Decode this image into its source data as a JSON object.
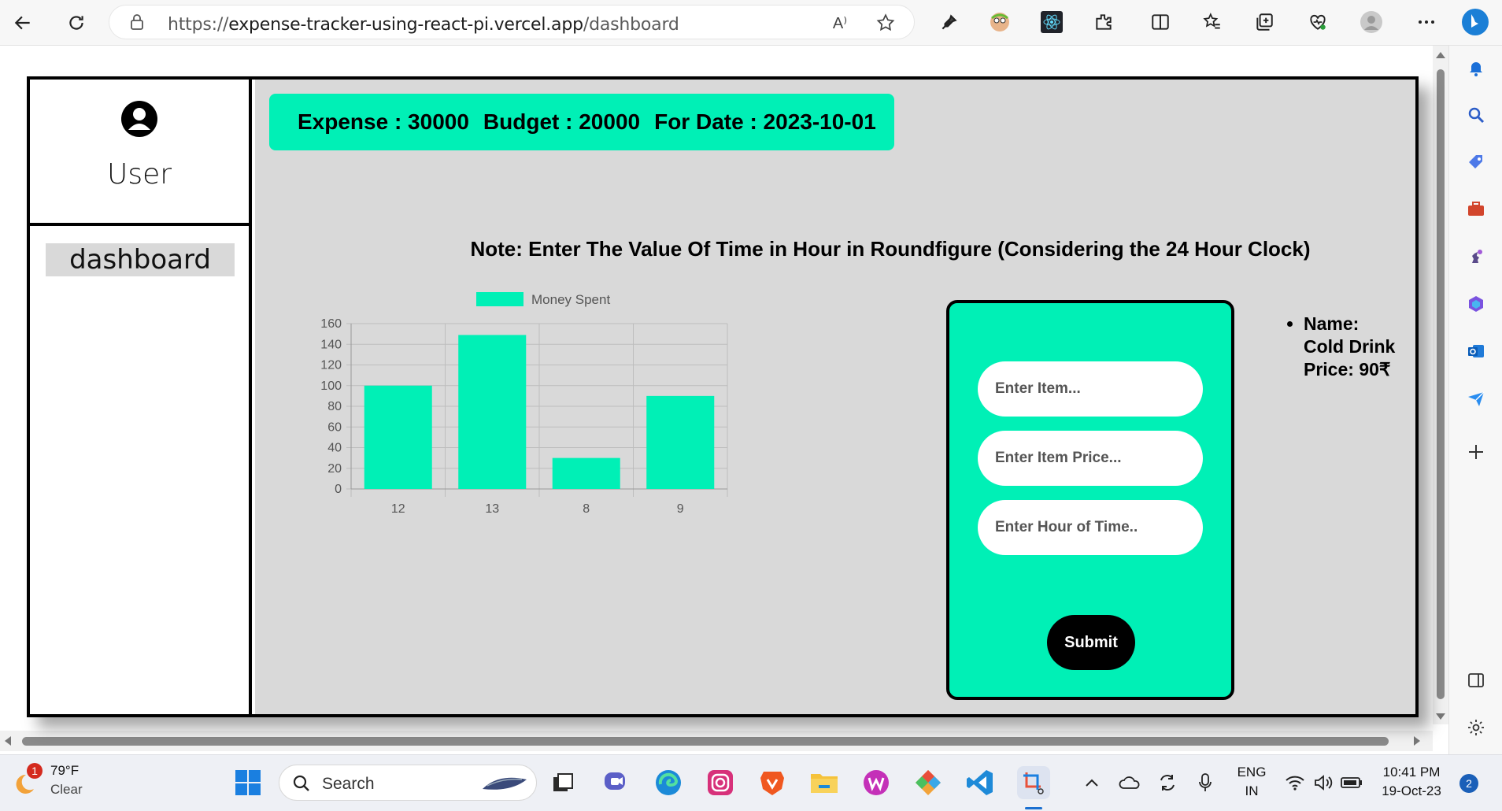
{
  "browser": {
    "url_prefix": "https://",
    "url_host": "expense-tracker-using-react-pi.vercel.app",
    "url_path": "/dashboard",
    "read_aloud": "A⁾"
  },
  "sidebar": {
    "user_label": "User",
    "nav_items": [
      {
        "label": "dashboard"
      }
    ]
  },
  "summary": {
    "expense": "Expense : 30000",
    "budget": "Budget : 20000",
    "date": "For Date : 2023-10-01"
  },
  "note": "Note: Enter The Value Of Time in Hour in Roundfigure (Considering the 24 Hour Clock)",
  "chart_data": {
    "type": "bar",
    "categories": [
      "12",
      "13",
      "8",
      "9"
    ],
    "series": [
      {
        "name": "Money Spent",
        "values": [
          100,
          149,
          30,
          90
        ],
        "color": "#00f0b6"
      }
    ],
    "ylim": [
      0,
      160
    ],
    "yticks": [
      0,
      20,
      40,
      60,
      80,
      100,
      120,
      140,
      160
    ],
    "legend": "top",
    "grid": true
  },
  "form": {
    "item_placeholder": "Enter Item...",
    "price_placeholder": "Enter Item Price...",
    "hour_placeholder": "Enter Hour of Time..",
    "submit_label": "Submit"
  },
  "items": [
    {
      "name": "Name:",
      "name_value": "Cold Drink",
      "price": "Price: 90₹"
    }
  ],
  "taskbar": {
    "weather_badge": "1",
    "temp": "79°F",
    "condition": "Clear",
    "search": "Search",
    "lang_1": "ENG",
    "lang_2": "IN",
    "time": "10:41 PM",
    "date": "19-Oct-23",
    "notif_count": "2"
  },
  "colors": {
    "accent": "#00f0b6",
    "panel": "#d9d9d9"
  }
}
